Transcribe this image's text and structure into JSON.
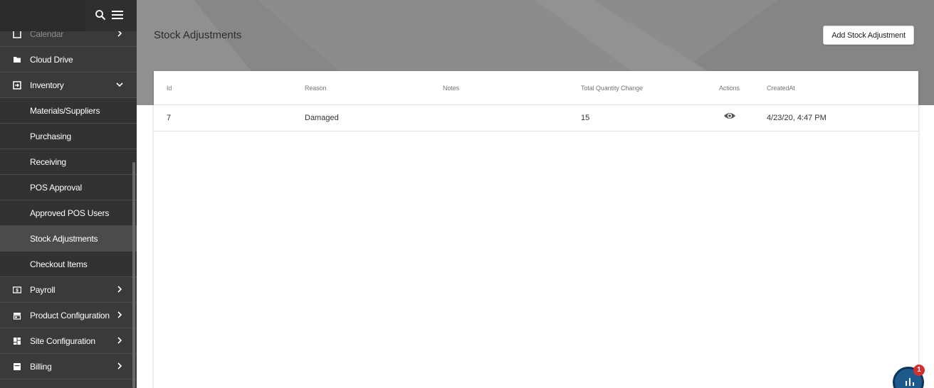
{
  "sidebar": {
    "items": [
      {
        "label": "Calendar",
        "icon": "calendar-icon"
      },
      {
        "label": "Cloud Drive",
        "icon": "folder-icon"
      },
      {
        "label": "Inventory",
        "icon": "inventory-icon"
      },
      {
        "label": "Materials/Suppliers"
      },
      {
        "label": "Purchasing"
      },
      {
        "label": "Receiving"
      },
      {
        "label": "POS Approval"
      },
      {
        "label": "Approved POS Users"
      },
      {
        "label": "Stock Adjustments"
      },
      {
        "label": "Checkout Items"
      },
      {
        "label": "Payroll",
        "icon": "payroll-icon"
      },
      {
        "label": "Product Configuration",
        "icon": "store-icon"
      },
      {
        "label": "Site Configuration",
        "icon": "dashboard-icon"
      },
      {
        "label": "Billing",
        "icon": "billing-icon"
      }
    ]
  },
  "page": {
    "title": "Stock Adjustments",
    "add_button": "Add Stock Adjustment"
  },
  "table": {
    "headers": [
      "Id",
      "Reason",
      "Notes",
      "Total Quantity Change",
      "Actions",
      "CreatedAt"
    ],
    "rows": [
      {
        "id": "7",
        "reason": "Damaged",
        "notes": "",
        "total_quantity_change": "15",
        "action_icon": "eye-icon",
        "created_at": "4/23/20, 4:47 PM"
      }
    ]
  },
  "widget": {
    "badge": "1",
    "icon": "chart-icon"
  },
  "colors": {
    "sidebar": "#3a3a3a",
    "header_band": "#8c8c8c",
    "badge": "#d32f2f",
    "widget": "#1e5a8c"
  }
}
